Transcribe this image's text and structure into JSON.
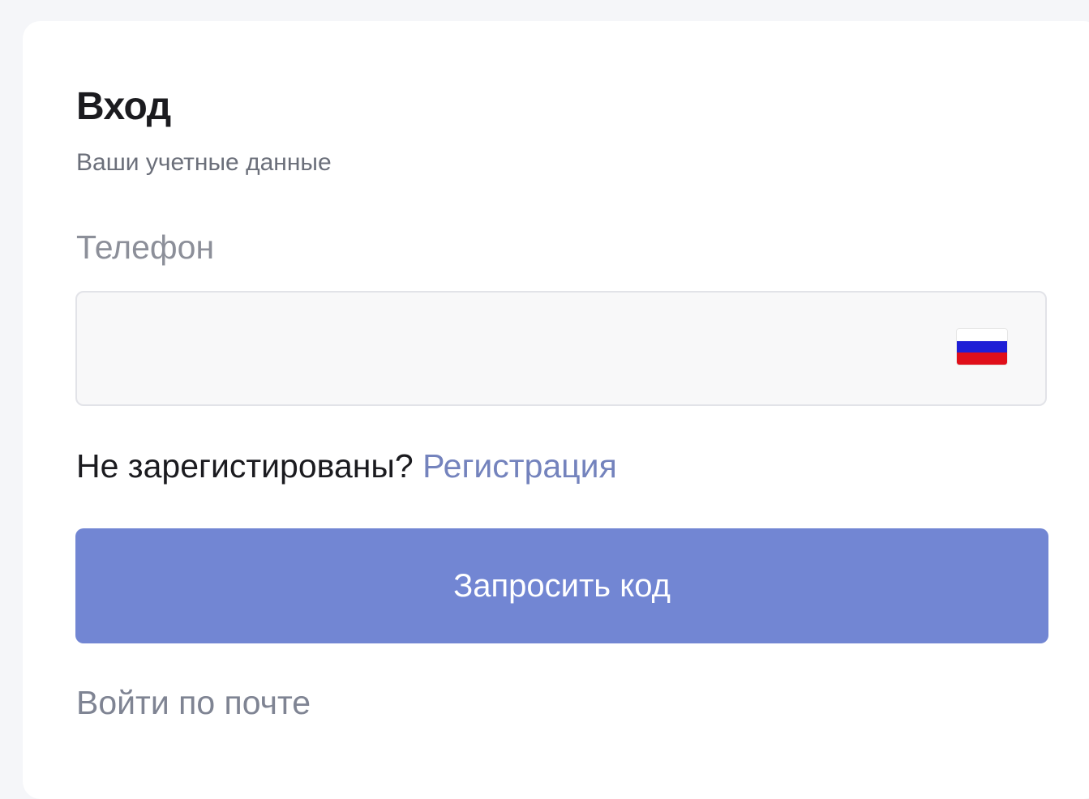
{
  "login": {
    "title": "Вход",
    "subtitle": "Ваши учетные данные",
    "phone_label": "Телефон",
    "phone_value": "",
    "phone_placeholder": "",
    "country_flag_icon": "russia-flag-icon",
    "not_registered_text": "Не зарегистированы?",
    "register_link": "Регистрация",
    "submit_label": "Запросить код",
    "email_login_link": "Войти по почте"
  },
  "colors": {
    "button_bg": "#7286d3",
    "link": "#7483bd",
    "muted_text": "#8c8f99",
    "title_text": "#1b1b1f"
  }
}
